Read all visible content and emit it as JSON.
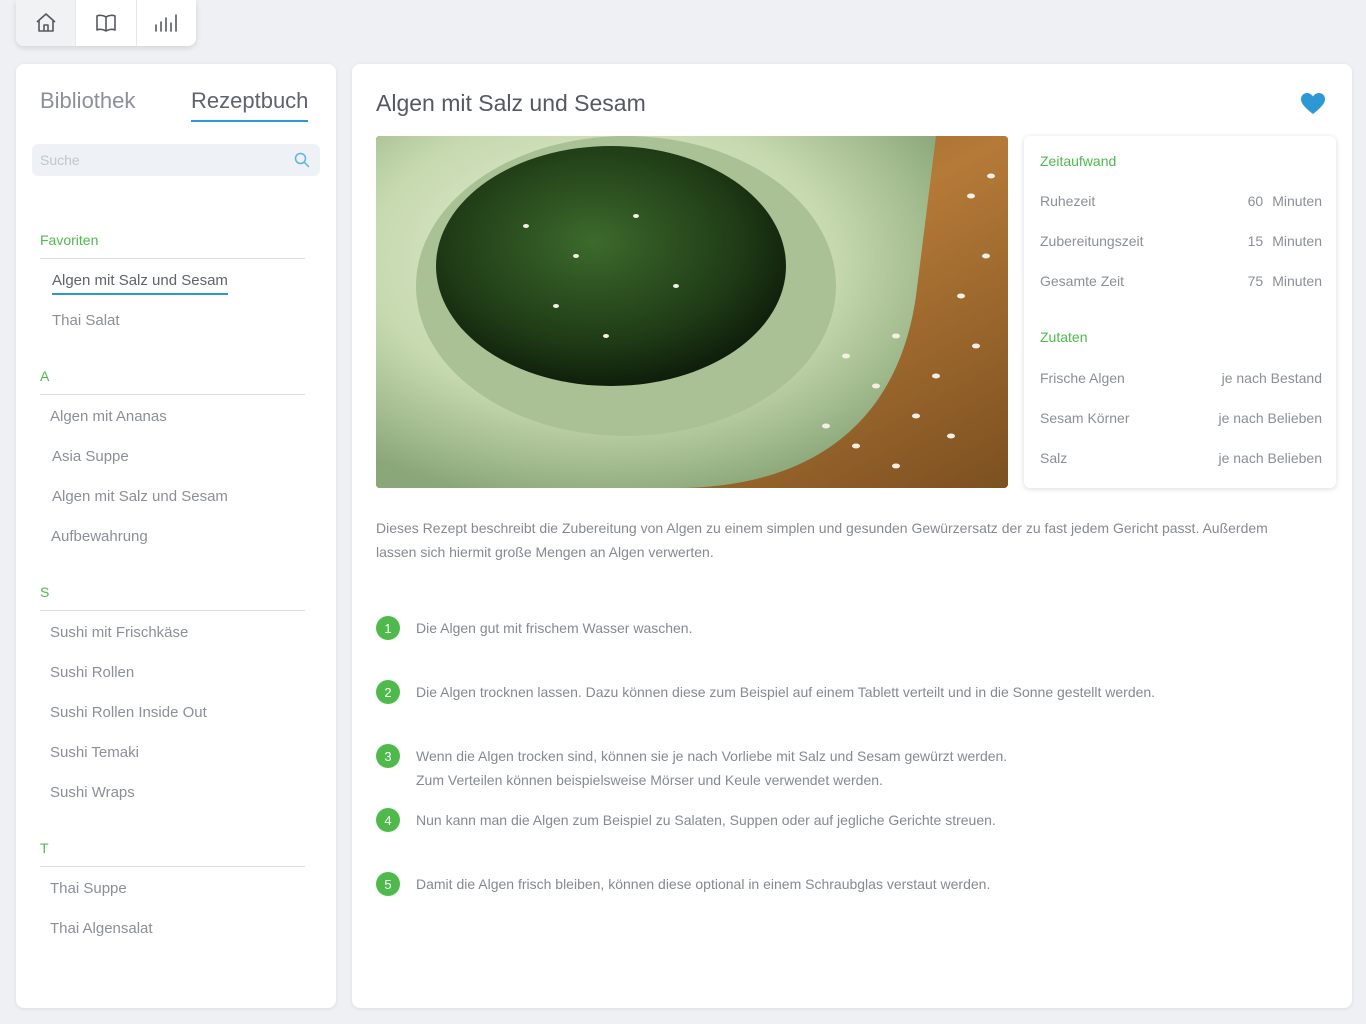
{
  "topnav": {
    "items": [
      {
        "icon": "home-icon"
      },
      {
        "icon": "book-icon"
      },
      {
        "icon": "bar-chart-icon"
      }
    ]
  },
  "sidebar": {
    "tabs": [
      "Bibliothek",
      "Rezeptbuch"
    ],
    "active_tab": "Rezeptbuch",
    "search": {
      "placeholder": "Suche",
      "value": ""
    },
    "sections": [
      {
        "header": "Favoriten",
        "items": [
          "Algen mit Salz und Sesam",
          "Thai Salat"
        ]
      },
      {
        "header": "A",
        "items": [
          "Algen mit Ananas",
          "Asia Suppe",
          "Algen mit Salz und Sesam",
          "Aufbewahrung"
        ]
      },
      {
        "header": "S",
        "items": [
          "Sushi mit Frischkäse",
          "Sushi Rollen",
          "Sushi Rollen Inside Out",
          "Sushi Temaki",
          "Sushi Wraps"
        ]
      },
      {
        "header": "T",
        "items": [
          "Thai Suppe",
          "Thai Algensalat"
        ]
      }
    ]
  },
  "recipe": {
    "title": "Algen mit Salz und Sesam",
    "favorite": true,
    "time": {
      "header": "Zeitaufwand",
      "rows": [
        {
          "label": "Ruhezeit",
          "value": "60",
          "unit": "Minuten"
        },
        {
          "label": "Zubereitungszeit",
          "value": "15",
          "unit": "Minuten"
        },
        {
          "label": "Gesamte Zeit",
          "value": "75",
          "unit": "Minuten"
        }
      ]
    },
    "ingredients": {
      "header": "Zutaten",
      "rows": [
        {
          "label": "Frische Algen",
          "value": "je nach Bestand"
        },
        {
          "label": "Sesam Körner",
          "value": "je nach Belieben"
        },
        {
          "label": "Salz",
          "value": "je nach Belieben"
        }
      ]
    },
    "description": "Dieses Rezept beschreibt die Zubereitung von Algen zu einem simplen und gesunden Gewürzersatz der zu fast jedem Gericht passt. Außerdem lassen sich hiermit große Mengen an Algen verwerten.",
    "steps": [
      {
        "num": "1",
        "text": "Die Algen gut mit frischem Wasser waschen."
      },
      {
        "num": "2",
        "text": "Die Algen trocknen lassen. Dazu können diese zum Beispiel auf einem Tablett verteilt und in die Sonne gestellt werden."
      },
      {
        "num": "3",
        "text": "Wenn die Algen trocken sind, können sie je nach Vorliebe mit Salz und Sesam gewürzt werden."
      },
      {
        "num": "4",
        "text": "Nun kann man die Algen zum Beispiel zu Salaten, Suppen oder auf jegliche Gerichte streuen."
      },
      {
        "num": "5",
        "text": "Damit die Algen frisch bleiben, können diese optional in einem Schraubglas verstaut werden."
      }
    ],
    "step3_line2": "Zum Verteilen können beispielsweise Mörser und Keule verwendet werden."
  },
  "colors": {
    "accent_green": "#4fba4c",
    "accent_blue": "#2e98d6"
  }
}
